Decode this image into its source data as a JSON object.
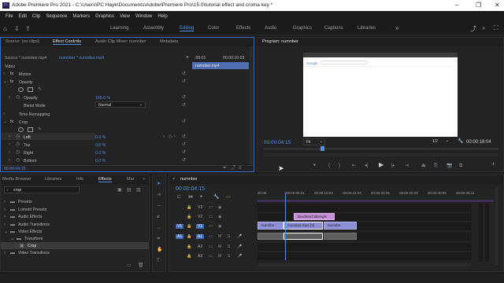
{
  "window": {
    "title": "Adobe Premiere Pro 2021 - C:\\Users\\PC Hayk\\Documents\\Adobe\\Premiere Pro\\15.0\\tutorial effect and croma key *"
  },
  "menu": [
    "File",
    "Edit",
    "Clip",
    "Sequence",
    "Markers",
    "Graphics",
    "View",
    "Window",
    "Help"
  ],
  "workspaces": [
    "Learning",
    "Assembly",
    "Editing",
    "Color",
    "Effects",
    "Audio",
    "Graphics",
    "Captions",
    "Libraries"
  ],
  "workspace_active": "Editing",
  "effect_controls": {
    "tabs": [
      "Source: (no clips)",
      "Effect Controls",
      "Audio Clip Mixer: numnber",
      "Metadata"
    ],
    "source": "Source * numnber.mp4",
    "sequence": "numnber * numnber.mp4",
    "time_start": ":05:01",
    "time_end": "00:00:10:03",
    "clip_name": "numnber.mp4",
    "video_label": "Video",
    "motion": "Motion",
    "opacity": "Opacity",
    "opacity_label": "Opacity",
    "opacity_value": "100.0 %",
    "blend_mode_label": "Blend Mode",
    "blend_mode": "Normal",
    "time_remapping": "Time Remapping",
    "crop": "Crop",
    "crop_left": "Left",
    "crop_left_value": "0.0 %",
    "crop_top": "Top",
    "crop_top_value": "0.0 %",
    "crop_right": "Right",
    "crop_right_value": "0.0 %",
    "crop_bottom": "Bottom",
    "crop_bottom_value": "0.0 %",
    "timecode": "00:00:04:15"
  },
  "program": {
    "title": "Program: numnber",
    "timecode": "00:00:04:15",
    "fit": "Fit",
    "ratio": "1/2",
    "duration": "00:00:18:04",
    "browser_logo": "Google"
  },
  "effects_panel": {
    "tabs": [
      "Media Browser",
      "Libraries",
      "Info",
      "Effects",
      "Mar"
    ],
    "search_value": "crop",
    "tree": [
      "Presets",
      "Lumetri Presets",
      "Audio Effects",
      "Audio Transitions",
      "Video Effects",
      "Transform",
      "Crop",
      "Video Transitions"
    ]
  },
  "timeline": {
    "title": "numnber",
    "timecode": "00:00:04:15",
    "ruler": [
      "00:00",
      "00:00:05:01",
      "00:00:10:03",
      "00:00:15:04",
      "00:00:20:05",
      "00:00:25:08",
      "00:00:30:09",
      "00:00:35:11"
    ],
    "tracks": [
      "V3",
      "V2",
      "V1",
      "A1",
      "A2",
      "A3"
    ],
    "src_v": "V1",
    "src_a": "A1",
    "clips": {
      "overlay": "Bewhitechildsingle",
      "v1a": "numnbe",
      "v1b": "numnber.mp4 [V]",
      "v1c": "numnbe"
    },
    "playhead_fraction": 0.128
  }
}
